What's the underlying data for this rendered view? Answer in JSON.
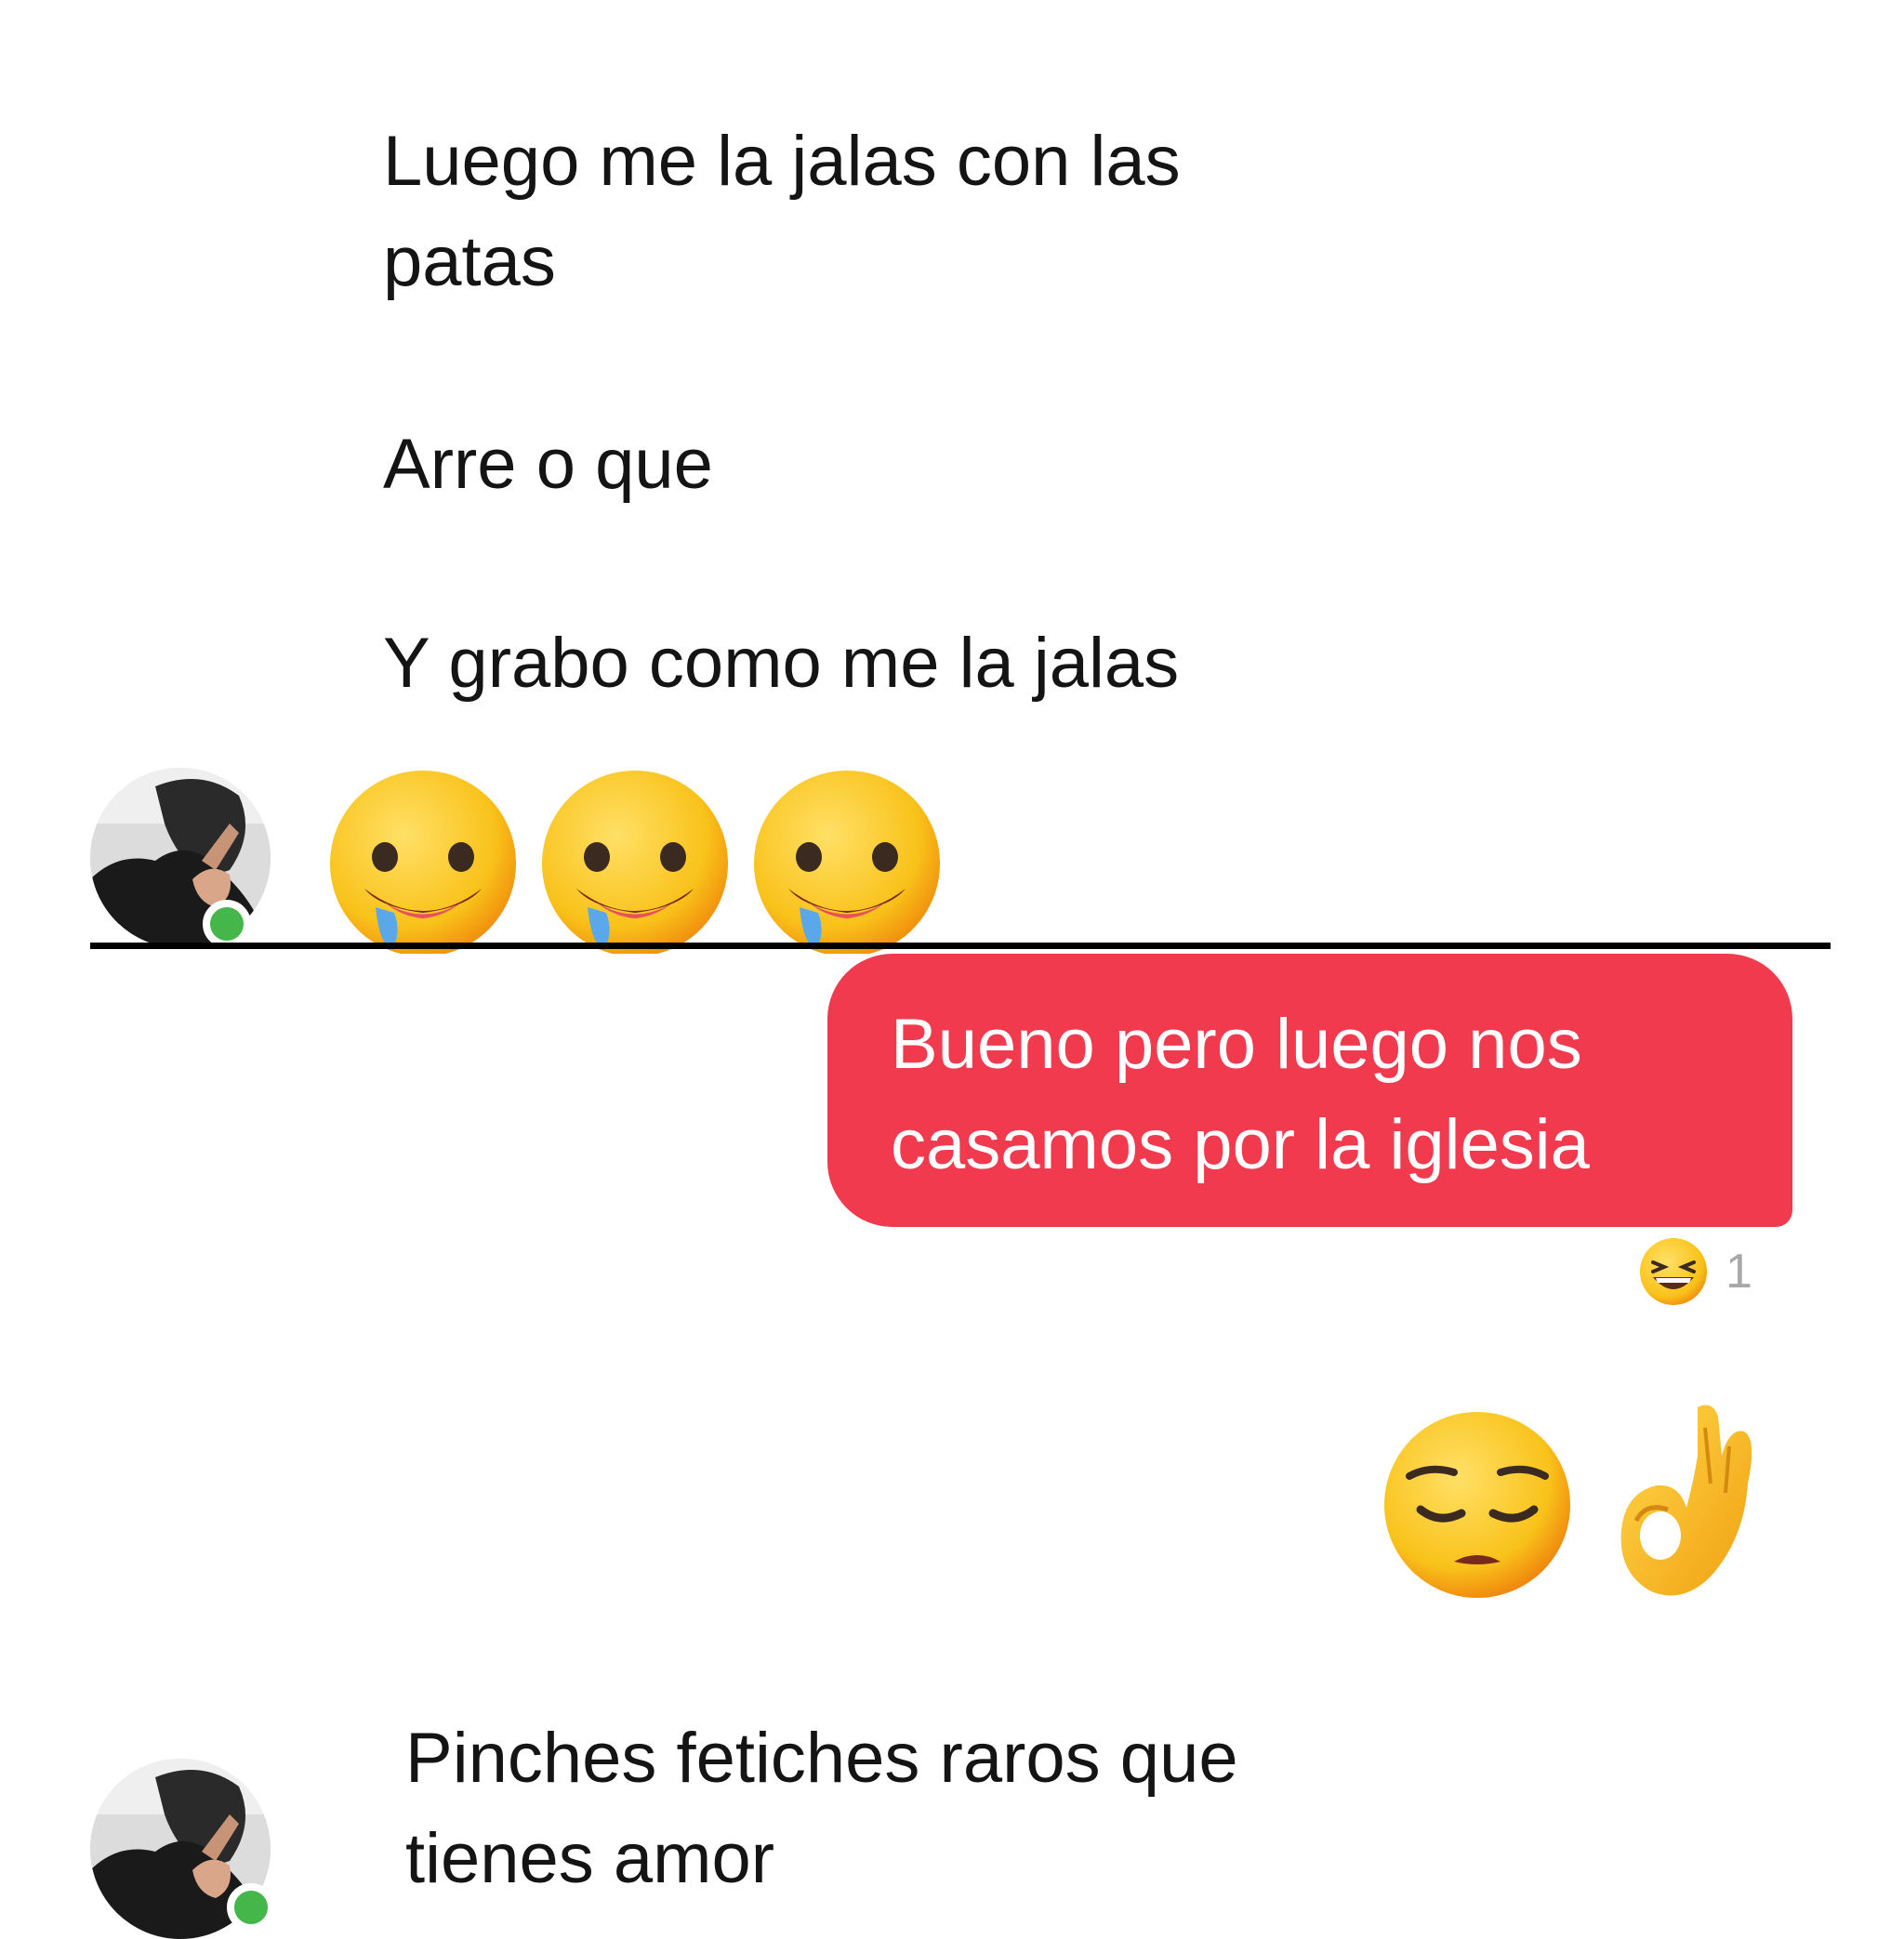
{
  "conversation": {
    "incoming_top": {
      "line1": "Luego me la jalas con las\npatas",
      "line2": "Arre o que",
      "line3": "Y grabo como me la jalas",
      "emojis": [
        "drooling-face",
        "drooling-face",
        "drooling-face"
      ]
    },
    "outgoing": {
      "bubble_text": "Bueno pero luego nos\ncasamos por la iglesia",
      "bubble_color": "#f23a4e",
      "reaction": {
        "emoji": "grinning-squinting-face",
        "count": "1"
      },
      "emojis": [
        "pensive-face",
        "ok-hand"
      ]
    },
    "incoming_bottom": {
      "text": "Pinches fetiches raros que\ntienes amor"
    },
    "online_status_color": "#45b649"
  }
}
